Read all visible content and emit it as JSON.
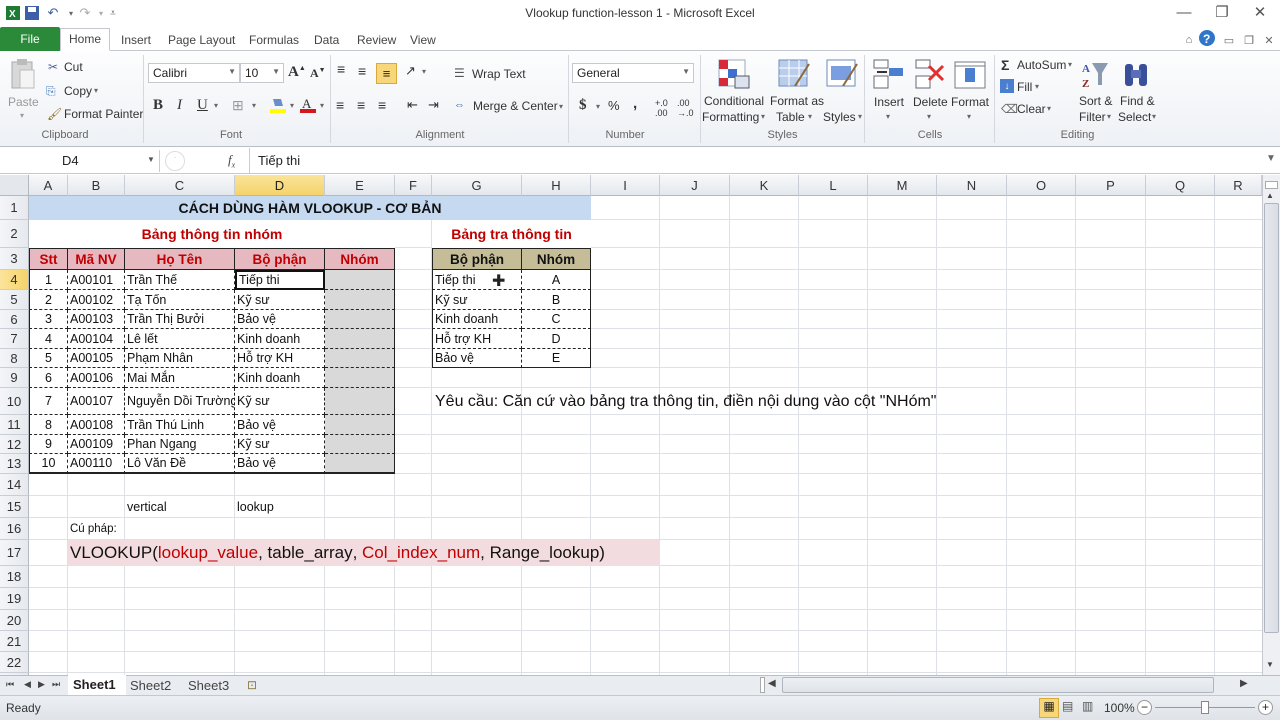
{
  "window": {
    "title": "Vlookup function-lesson 1 - Microsoft Excel"
  },
  "quick_access": [
    "excel-logo",
    "save",
    "undo",
    "redo",
    "customize"
  ],
  "tabs": [
    {
      "label": "File"
    },
    {
      "label": "Home",
      "active": true
    },
    {
      "label": "Insert"
    },
    {
      "label": "Page Layout"
    },
    {
      "label": "Formulas"
    },
    {
      "label": "Data"
    },
    {
      "label": "Review"
    },
    {
      "label": "View"
    }
  ],
  "ribbon": {
    "clipboard": {
      "label": "Clipboard",
      "paste": "Paste",
      "cut": "Cut",
      "copy": "Copy",
      "format_painter": "Format Painter"
    },
    "font": {
      "label": "Font",
      "font_name": "Calibri",
      "font_size": "10",
      "bold": "B",
      "italic": "I",
      "underline": "U",
      "font_color": "#d4171f",
      "fill_color": "#ffff00"
    },
    "alignment": {
      "label": "Alignment",
      "wrap_text": "Wrap Text",
      "merge_center": "Merge & Center"
    },
    "number": {
      "label": "Number",
      "format": "General",
      "currency": "$",
      "percent": "%",
      "comma": ","
    },
    "styles": {
      "label": "Styles",
      "conditional_1": "Conditional",
      "conditional_2": "Formatting",
      "format_table_1": "Format as",
      "format_table_2": "Table",
      "cell_styles_1": "Cell",
      "cell_styles_2": "Styles"
    },
    "cells": {
      "label": "Cells",
      "insert": "Insert",
      "delete": "Delete",
      "format": "Format"
    },
    "editing": {
      "label": "Editing",
      "autosum": "AutoSum",
      "fill": "Fill",
      "clear": "Clear",
      "sort_1": "Sort &",
      "sort_2": "Filter",
      "find_1": "Find &",
      "find_2": "Select"
    }
  },
  "formula_bar": {
    "name_box": "D4",
    "fx": "fx",
    "value": "Tiếp thi"
  },
  "columns": [
    "A",
    "B",
    "C",
    "D",
    "E",
    "F",
    "G",
    "H",
    "I",
    "J",
    "K",
    "L",
    "M",
    "N",
    "O",
    "P",
    "Q",
    "R"
  ],
  "selected_column": "D",
  "rows": [
    "1",
    "2",
    "3",
    "4",
    "5",
    "6",
    "7",
    "8",
    "9",
    "10",
    "11",
    "12",
    "13",
    "14",
    "15",
    "16",
    "17",
    "18",
    "19",
    "20",
    "21",
    "22"
  ],
  "selected_row": "4",
  "sheet": {
    "title": "CÁCH DÙNG HÀM VLOOKUP - CƠ BẢN",
    "main_table": {
      "caption": "Bảng thông tin nhóm",
      "headers": [
        "Stt",
        "Mã NV",
        "Họ Tên",
        "Bộ phận",
        "Nhóm"
      ],
      "rows": [
        [
          "1",
          "A00101",
          "Trần Thế",
          "Tiếp thi",
          ""
        ],
        [
          "2",
          "A00102",
          "Tạ Tốn",
          "Kỹ sư",
          ""
        ],
        [
          "3",
          "A00103",
          "Trần Thị Bưởi",
          "Bảo vệ",
          ""
        ],
        [
          "4",
          "A00104",
          "Lê lết",
          "Kinh doanh",
          ""
        ],
        [
          "5",
          "A00105",
          "Phạm Nhân",
          "Hỗ trợ KH",
          ""
        ],
        [
          "6",
          "A00106",
          "Mai Mắn",
          "Kinh doanh",
          ""
        ],
        [
          "7",
          "A00107",
          "Nguyễn Dồi Trường",
          "Kỹ sư",
          ""
        ],
        [
          "8",
          "A00108",
          "Trần Thú Linh",
          "Bảo vệ",
          ""
        ],
        [
          "9",
          "A00109",
          "Phan Ngang",
          "Kỹ sư",
          ""
        ],
        [
          "10",
          "A00110",
          "Lô Văn Đề",
          "Bảo vệ",
          ""
        ]
      ]
    },
    "lookup_table": {
      "caption": "Bảng tra thông tin",
      "headers": [
        "Bộ phận",
        "Nhóm"
      ],
      "rows": [
        [
          "Tiếp thi",
          "A"
        ],
        [
          "Kỹ sư",
          "B"
        ],
        [
          "Kinh doanh",
          "C"
        ],
        [
          "Hỗ trợ KH",
          "D"
        ],
        [
          "Bảo vệ",
          "E"
        ]
      ]
    },
    "requirement": "Yêu cầu: Căn cứ vào bảng tra thông tin, điền nội dung vào cột \"NHóm\"",
    "vertical": "vertical",
    "lookup": "lookup",
    "syntax_label": "Cú pháp:",
    "syntax": {
      "fn": "VLOOKUP(",
      "arg1": "lookup_value",
      ", ": ", ",
      "arg2": "table_array",
      "sep2": ", ",
      "arg3": "Col_index_num",
      "sep3": ", ",
      "arg4": "Range_lookup)"
    }
  },
  "sheet_tabs": [
    {
      "label": "Sheet1",
      "active": true
    },
    {
      "label": "Sheet2"
    },
    {
      "label": "Sheet3"
    }
  ],
  "status": {
    "text": "Ready",
    "zoom": "100%"
  },
  "colors": {
    "title_bg": "#c5d9f1",
    "header_pink": "#e6b8c0",
    "header_khaki": "#c4bd97",
    "caption_red": "#c00000",
    "syntax_bg": "#f2dcdf",
    "nhom_fill": "#d9d9d9",
    "accent_green": "#2a8a3a"
  }
}
